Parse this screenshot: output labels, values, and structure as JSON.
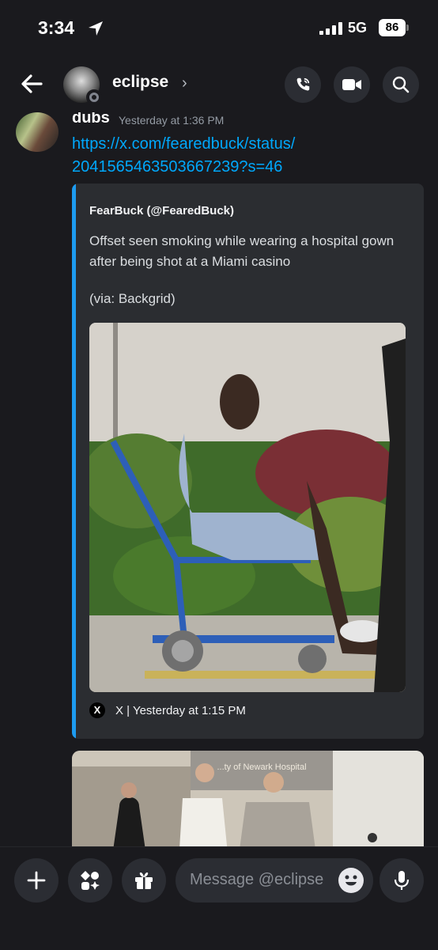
{
  "status_bar": {
    "time": "3:34",
    "network": "5G",
    "battery": "86"
  },
  "header": {
    "channel_name": "eclipse"
  },
  "message": {
    "author": "dubs",
    "timestamp": "Yesterday at 1:36 PM",
    "link_line1": "https://x.com/fearedbuck/status/",
    "link_line2": "2041565463503667239?s=46"
  },
  "embed": {
    "author": "FearBuck (@FearedBuck)",
    "description": "Offset seen smoking while wearing a hospital gown after being shot at a Miami casino",
    "via": "(via: Backgrid)",
    "footer_icon": "X",
    "footer": "X | Yesterday at 1:15 PM"
  },
  "second_image_sign": "...ty of Newark Hospital",
  "composer": {
    "placeholder": "Message @eclipse"
  },
  "colors": {
    "background": "#1a1a1e",
    "embed_bg": "#2b2d31",
    "accent": "#1d9bf0",
    "link": "#00a8fc"
  },
  "icons": [
    "location-arrow-icon",
    "signal-icon",
    "back-arrow-icon",
    "chevron-right-icon",
    "phone-icon",
    "video-icon",
    "search-icon",
    "plus-icon",
    "apps-icon",
    "gift-icon",
    "emoji-icon",
    "mic-icon",
    "x-logo-icon"
  ]
}
